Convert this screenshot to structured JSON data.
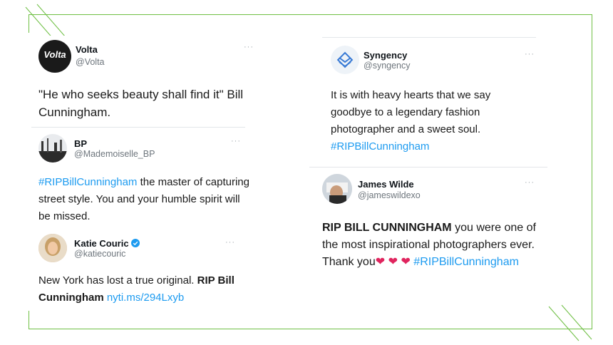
{
  "tweets": {
    "volta": {
      "name": "Volta",
      "handle": "@Volta",
      "avatar_text": "Volta",
      "text": "\"He who seeks beauty shall find it\" Bill Cunningham."
    },
    "bp": {
      "name": "BP",
      "handle": "@Mademoiselle_BP",
      "hashtag": "#RIPBillCunningham",
      "text": " the master of capturing street style. You and your humble spirit will be missed."
    },
    "katie": {
      "name": "Katie Couric",
      "handle": "@katiecouric",
      "text_start": "New York has lost a true original. ",
      "text_bold": "RIP Bill Cunningham",
      "link": "nyti.ms/294Lxyb"
    },
    "syngency": {
      "name": "Syngency",
      "handle": "@syngency",
      "text": "It is with heavy hearts that we say goodbye to a legendary fashion photographer and a sweet soul.",
      "hashtag": "#RIPBillCunningham"
    },
    "james": {
      "name": "James Wilde",
      "handle": "@jameswildexo",
      "text_bold": "RIP BILL CUNNINGHAM",
      "text": " you were one of the most inspirational photographers ever. Thank you",
      "hashtag": "#RIPBillCunningham"
    }
  },
  "more_label": "···",
  "colors": {
    "accent_green": "#6fbf44",
    "link_blue": "#1d9bf0",
    "verified_blue": "#1d9bf0",
    "heart_red": "#e0245e"
  }
}
